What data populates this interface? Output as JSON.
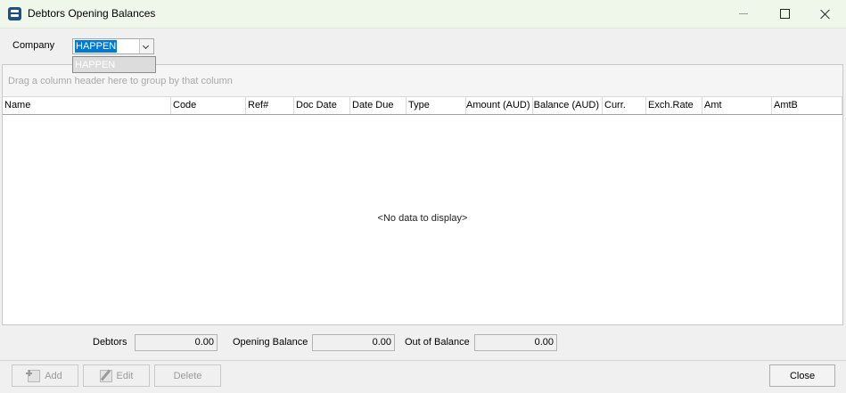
{
  "window": {
    "title": "Debtors Opening Balances"
  },
  "company": {
    "label": "Company",
    "value": "HAPPEN",
    "options": [
      "HAPPEN"
    ]
  },
  "grid": {
    "group_hint": "Drag a column header here to group by that column",
    "columns": [
      "Name",
      "Code",
      "Ref#",
      "Doc Date",
      "Date Due",
      "Type",
      "Amount (AUD)",
      "Balance (AUD)",
      "Curr.",
      "Exch.Rate",
      "Amt",
      "AmtB"
    ],
    "empty_message": "<No data to display>"
  },
  "totals": {
    "debtors_label": "Debtors",
    "debtors_value": "0.00",
    "opening_label": "Opening Balance",
    "opening_value": "0.00",
    "out_label": "Out of Balance",
    "out_value": "0.00"
  },
  "buttons": {
    "add": "Add",
    "edit": "Edit",
    "delete": "Delete",
    "close": "Close"
  },
  "colors": {
    "titlebar": "#eef7ea",
    "selection": "#0078d7",
    "disabled_text": "#9a9a9a"
  }
}
